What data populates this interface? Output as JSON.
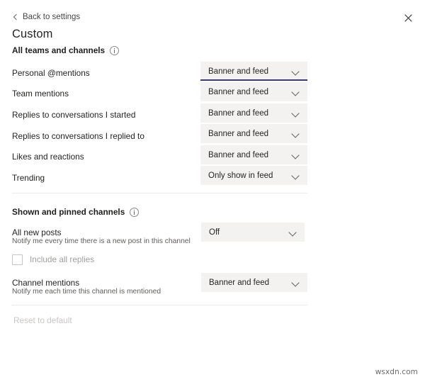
{
  "header": {
    "back_label": "Back to settings",
    "back_icon": "chevron-left-icon",
    "close_icon": "close-icon",
    "title": "Custom"
  },
  "sections": [
    {
      "heading": "All teams and channels",
      "info_icon": "info-icon",
      "rows": [
        {
          "label": "Personal @mentions",
          "value": "Banner and feed",
          "focused": true
        },
        {
          "label": "Team mentions",
          "value": "Banner and feed",
          "focused": false
        },
        {
          "label": "Replies to conversations I started",
          "value": "Banner and feed",
          "focused": false
        },
        {
          "label": "Replies to conversations I replied to",
          "value": "Banner and feed",
          "focused": false
        },
        {
          "label": "Likes and reactions",
          "value": "Banner and feed",
          "focused": false
        },
        {
          "label": "Trending",
          "value": "Only show in feed",
          "focused": false
        }
      ]
    },
    {
      "heading": "Shown and pinned channels",
      "info_icon": "info-icon",
      "rows": [
        {
          "label": "All new posts",
          "sub": "Notify me every time there is a new post in this channel",
          "value": "Off"
        },
        {
          "label": "Channel mentions",
          "sub": "Notify me each time this channel is mentioned",
          "value": "Banner and feed"
        }
      ],
      "checkbox": {
        "label": "Include all replies",
        "checked": false,
        "disabled": true
      }
    }
  ],
  "footer": {
    "reset_label": "Reset to default"
  },
  "watermark": "wsxdn.com",
  "colors": {
    "dropdown_bg": "#f3f2f1",
    "focus_underline": "#3b3a78",
    "text_primary": "#252423",
    "text_secondary": "#605e5c",
    "text_disabled": "#a19f9d",
    "divider": "#edebe9"
  }
}
